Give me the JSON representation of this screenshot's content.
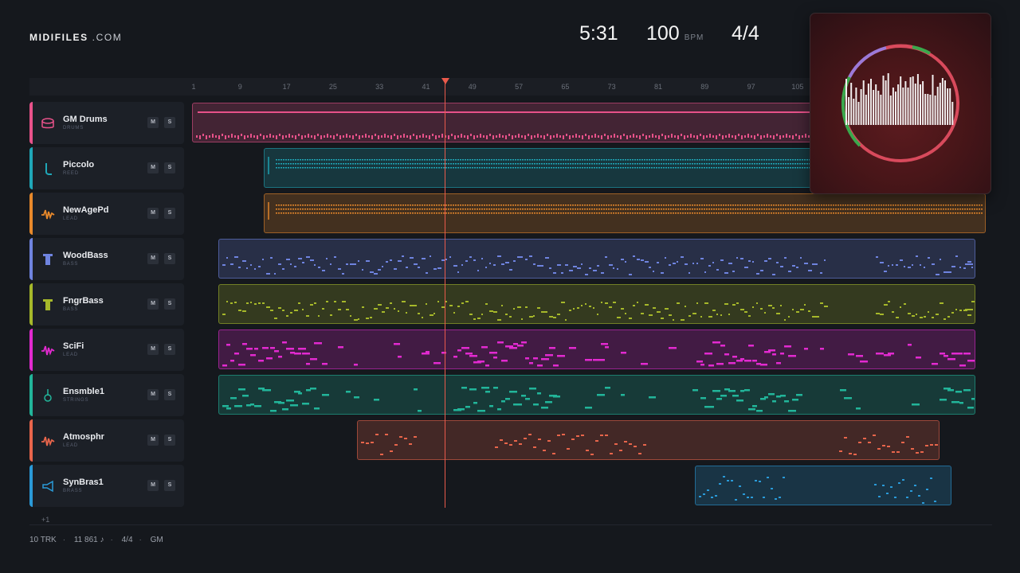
{
  "brand": {
    "bold": "MIDIFILES",
    "suffix": ".COM"
  },
  "transport": {
    "time": "5:31",
    "tempo": "100",
    "tempo_unit": "BPM",
    "signature": "4/4"
  },
  "ruler": {
    "ticks": [
      "1",
      "9",
      "17",
      "25",
      "33",
      "41",
      "49",
      "57",
      "65",
      "73",
      "81",
      "89",
      "97",
      "105"
    ]
  },
  "tracks": [
    {
      "name": "GM Drums",
      "category": "DRUMS",
      "color": "#e8528a",
      "icon": "drum-icon",
      "mute": "M",
      "solo": "S"
    },
    {
      "name": "Piccolo",
      "category": "REED",
      "color": "#1fa7b8",
      "icon": "reed-icon",
      "mute": "M",
      "solo": "S"
    },
    {
      "name": "NewAgePd",
      "category": "LEAD",
      "color": "#e8892b",
      "icon": "waveform-icon",
      "mute": "M",
      "solo": "S"
    },
    {
      "name": "WoodBass",
      "category": "BASS",
      "color": "#6f84e0",
      "icon": "bass-icon",
      "mute": "M",
      "solo": "S"
    },
    {
      "name": "FngrBass",
      "category": "BASS",
      "color": "#a6b82a",
      "icon": "bass-icon",
      "mute": "M",
      "solo": "S"
    },
    {
      "name": "SciFi",
      "category": "LEAD",
      "color": "#e22ad0",
      "icon": "waveform-icon",
      "mute": "M",
      "solo": "S"
    },
    {
      "name": "Ensmble1",
      "category": "STRINGS",
      "color": "#22b59a",
      "icon": "strings-icon",
      "mute": "M",
      "solo": "S"
    },
    {
      "name": "Atmosphr",
      "category": "LEAD",
      "color": "#e8654b",
      "icon": "waveform-icon",
      "mute": "M",
      "solo": "S"
    },
    {
      "name": "SynBras1",
      "category": "BRASS",
      "color": "#2a9ad8",
      "icon": "brass-icon",
      "mute": "M",
      "solo": "S"
    }
  ],
  "more_tracks": "+1",
  "footer": {
    "tracks": "10 TRK",
    "notes": "11 861 ♪",
    "signature": "4/4",
    "standard": "GM"
  }
}
